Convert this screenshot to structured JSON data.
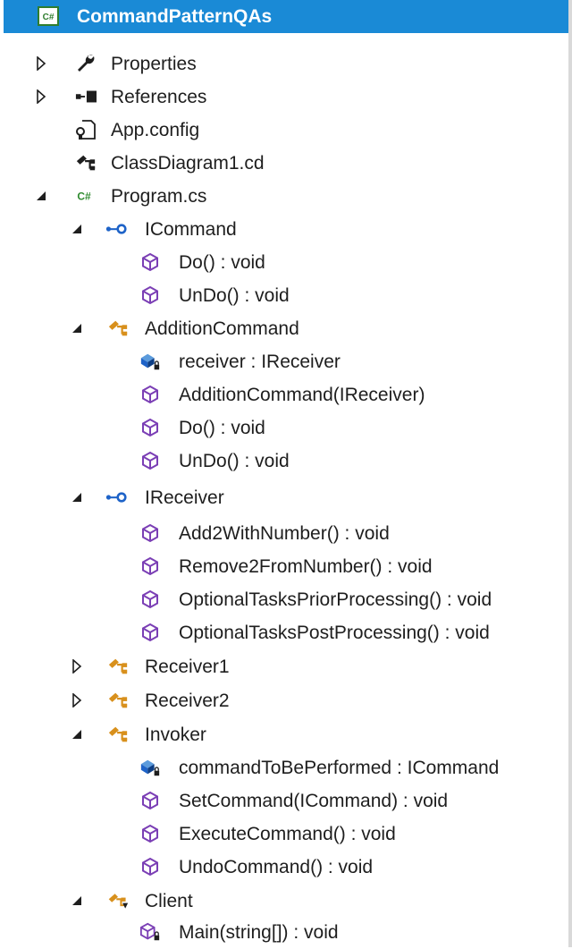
{
  "solution_explorer": {
    "project": {
      "name": "CommandPatternQAs",
      "icon": "csharp-project-icon"
    },
    "nodes": {
      "properties": {
        "label": "Properties",
        "icon": "wrench-icon",
        "state": "collapsed"
      },
      "references": {
        "label": "References",
        "icon": "references-icon",
        "state": "collapsed"
      },
      "app_config": {
        "label": "App.config",
        "icon": "config-file-icon"
      },
      "class_diagram": {
        "label": "ClassDiagram1.cd",
        "icon": "class-diagram-icon"
      },
      "program_cs": {
        "label": "Program.cs",
        "icon": "csharp-file-icon",
        "state": "expanded"
      },
      "icommand": {
        "label": "ICommand",
        "icon": "interface-icon",
        "state": "expanded",
        "members": [
          "Do() : void",
          "UnDo() : void"
        ]
      },
      "addition_command": {
        "label": "AdditionCommand",
        "icon": "class-icon",
        "state": "expanded",
        "field": "receiver : IReceiver",
        "members": [
          "AdditionCommand(IReceiver)",
          "Do() : void",
          "UnDo() : void"
        ]
      },
      "ireceiver": {
        "label": "IReceiver",
        "icon": "interface-icon",
        "state": "expanded",
        "members": [
          "Add2WithNumber() : void",
          "Remove2FromNumber() : void",
          "OptionalTasksPriorProcessing() : void",
          "OptionalTasksPostProcessing() : void"
        ]
      },
      "receiver1": {
        "label": "Receiver1",
        "icon": "class-icon",
        "state": "collapsed"
      },
      "receiver2": {
        "label": "Receiver2",
        "icon": "class-icon",
        "state": "collapsed"
      },
      "invoker": {
        "label": "Invoker",
        "icon": "class-icon",
        "state": "expanded",
        "field": "commandToBePerformed : ICommand",
        "members": [
          "SetCommand(ICommand) : void",
          "ExecuteCommand() : void",
          "UndoCommand() : void"
        ]
      },
      "client": {
        "label": "Client",
        "icon": "static-class-icon",
        "state": "expanded",
        "members": [
          "Main(string[]) : void"
        ]
      }
    }
  },
  "colors": {
    "selection": "#1a8ad6",
    "method_icon": "#7b3fb5",
    "class_icon": "#d8901c",
    "interface_icon": "#1e63c8",
    "csharp_green": "#2f8b2f"
  }
}
